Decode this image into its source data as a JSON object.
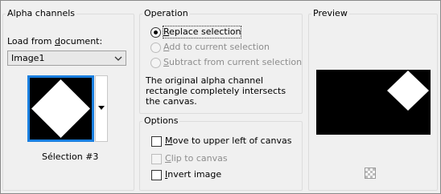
{
  "alpha_channels": {
    "title": "Alpha channels",
    "load_label_pre": "Load from ",
    "load_label_u": "d",
    "load_label_post": "ocument:",
    "selected_document": "Image1",
    "thumbnail_caption": "Sélection #3"
  },
  "operation": {
    "title": "Operation",
    "options": [
      {
        "u": "R",
        "rest": "eplace selection",
        "checked": true,
        "enabled": true
      },
      {
        "u": "A",
        "rest": "dd to current selection",
        "checked": false,
        "enabled": false
      },
      {
        "u": "S",
        "rest": "ubtract from current selection",
        "checked": false,
        "enabled": false
      }
    ],
    "info": "The original alpha channel rectangle completely intersects the canvas."
  },
  "options": {
    "title": "Options",
    "items": [
      {
        "u": "M",
        "rest": "ove to upper left of canvas",
        "checked": false,
        "enabled": true
      },
      {
        "u": "C",
        "rest": "lip to canvas",
        "checked": false,
        "enabled": false
      },
      {
        "u": "I",
        "rest": "nvert image",
        "checked": false,
        "enabled": true
      }
    ]
  },
  "preview": {
    "title": "Preview"
  },
  "icons": {
    "dropdown": "chevron-down-icon",
    "transparency": "checkerboard-icon"
  }
}
